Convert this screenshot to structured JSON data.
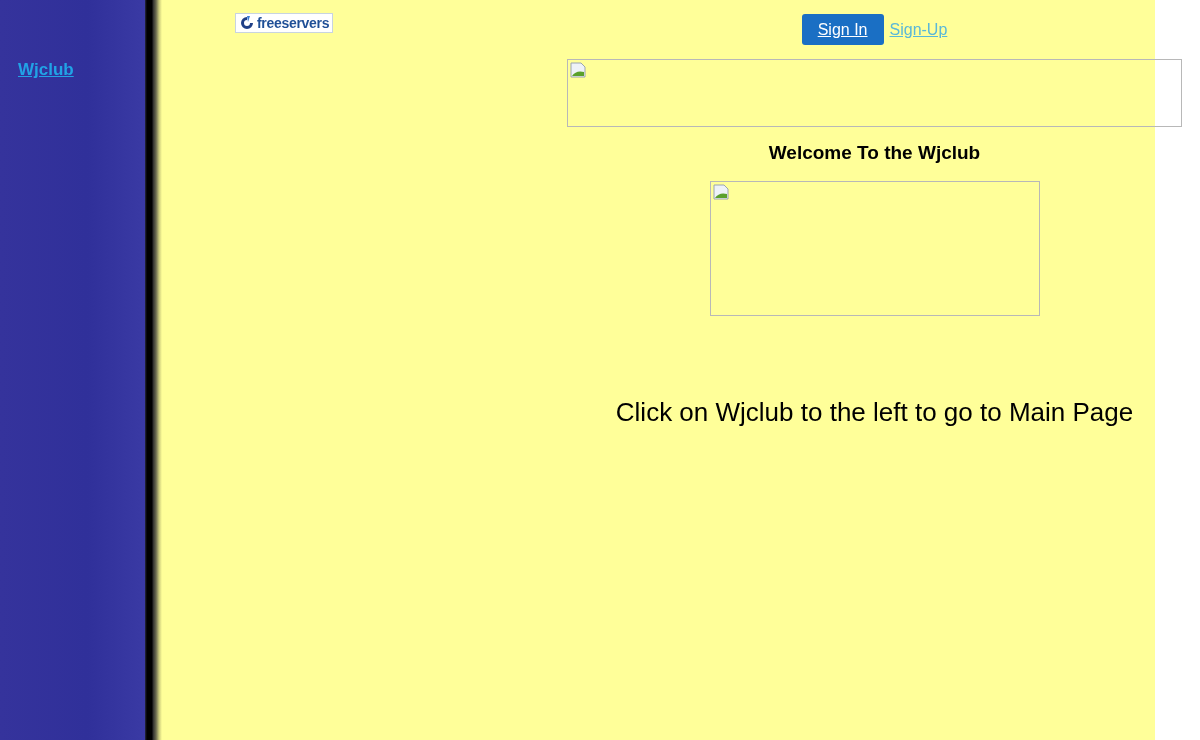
{
  "sidebar": {
    "link": "Wjclub"
  },
  "header": {
    "logo": "freeservers",
    "sign_in": "Sign In",
    "sign_up": "Sign-Up"
  },
  "heading": "Welcome To the Wjclub",
  "instruction": "Click on Wjclub to the left to go to Main Page"
}
